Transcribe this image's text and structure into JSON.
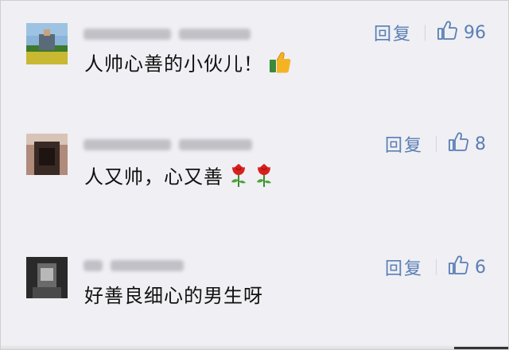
{
  "comments": [
    {
      "text": "人帅心善的小伙儿！",
      "reply_label": "回复",
      "like_count": "96",
      "emoji": [
        "thumbs-up-emoji"
      ]
    },
    {
      "text": "人又帅，心又善",
      "reply_label": "回复",
      "like_count": "8",
      "emoji": [
        "rose-emoji",
        "rose-emoji"
      ]
    },
    {
      "text": "好善良细心的男生呀",
      "reply_label": "回复",
      "like_count": "6",
      "emoji": []
    }
  ],
  "icons": {
    "like": "thumbs-up-outline-icon"
  },
  "colors": {
    "background": "#efeff4",
    "action_blue": "#5a7fb4",
    "text": "#111111"
  }
}
